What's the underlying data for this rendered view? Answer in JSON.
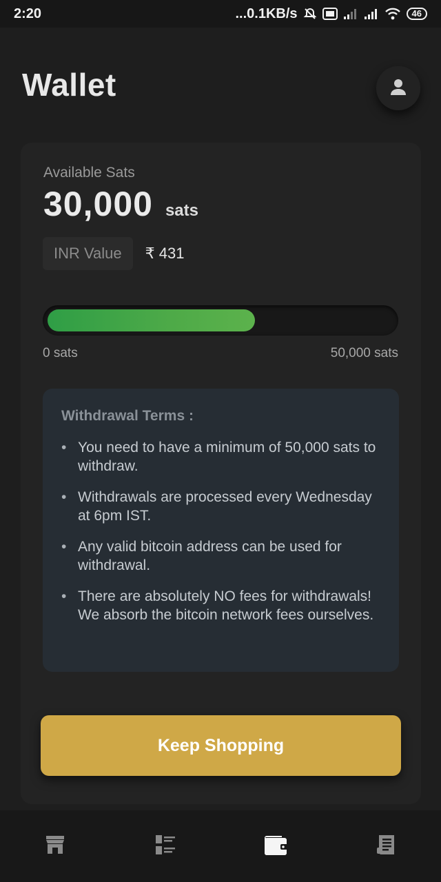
{
  "status_bar": {
    "time": "2:20",
    "network_speed": "...0.1KB/s",
    "battery": "46"
  },
  "header": {
    "title": "Wallet",
    "avatar_icon": "user-icon"
  },
  "wallet": {
    "available_label": "Available Sats",
    "amount": "30,000",
    "unit": "sats",
    "inr_label": "INR Value",
    "inr_value": "₹ 431",
    "progress": {
      "current": 30000,
      "max": 50000,
      "fraction": 0.6,
      "min_label": "0 sats",
      "max_label": "50,000 sats",
      "fill_color": "#4caf50"
    }
  },
  "terms": {
    "title": "Withdrawal Terms :",
    "items": [
      "You need to have a minimum of 50,000 sats to withdraw.",
      "Withdrawals are processed every Wednesday at 6pm IST.",
      "Any valid bitcoin address can be used for withdrawal.",
      "There are absolutely NO fees for withdrawals! We absorb the bitcoin network fees ourselves."
    ]
  },
  "actions": {
    "keep_shopping_label": "Keep Shopping",
    "accent_color": "#cfa847"
  },
  "bottom_nav": {
    "items": [
      {
        "icon": "store-icon",
        "active": false
      },
      {
        "icon": "list-icon",
        "active": false
      },
      {
        "icon": "wallet-icon",
        "active": true
      },
      {
        "icon": "receipt-icon",
        "active": false
      }
    ]
  }
}
